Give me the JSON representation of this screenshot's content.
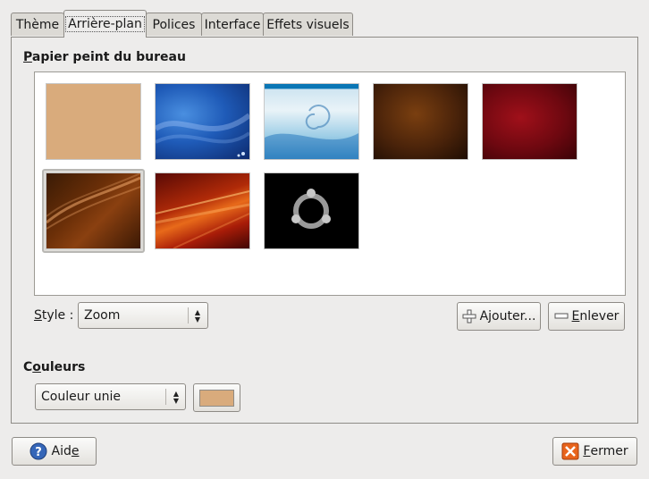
{
  "tabs": [
    {
      "label": "Thème"
    },
    {
      "label": "Arrière-plan"
    },
    {
      "label": "Polices"
    },
    {
      "label": "Interface"
    },
    {
      "label": "Effets visuels"
    }
  ],
  "wallpaper": {
    "title_mnemonic": "P",
    "title_rest": "apier peint du bureau",
    "style_label_mnemonic": "S",
    "style_label_rest": "tyle :",
    "style_value": "Zoom",
    "add_pre": "A",
    "add_mnemonic": "j",
    "add_post": "outer...",
    "remove_mnemonic": "E",
    "remove_post": "nlever",
    "thumbnails": [
      {
        "name": "wallpaper-plain-tan",
        "selected": false
      },
      {
        "name": "wallpaper-blue-swirl",
        "selected": false
      },
      {
        "name": "wallpaper-debian-swirl",
        "selected": false
      },
      {
        "name": "wallpaper-brown-texture",
        "selected": false
      },
      {
        "name": "wallpaper-dark-red",
        "selected": false
      },
      {
        "name": "wallpaper-brown-waves",
        "selected": true
      },
      {
        "name": "wallpaper-orange-rays",
        "selected": false
      },
      {
        "name": "wallpaper-ubuntu-logo",
        "selected": false
      }
    ]
  },
  "colors": {
    "title_pre": "C",
    "title_mnemonic": "o",
    "title_rest": "uleurs",
    "mode_value": "Couleur unie",
    "swatch_color": "#d9ab7c"
  },
  "footer": {
    "help_pre": "Aid",
    "help_mnemonic": "e",
    "close_mnemonic": "F",
    "close_rest": "ermer"
  }
}
